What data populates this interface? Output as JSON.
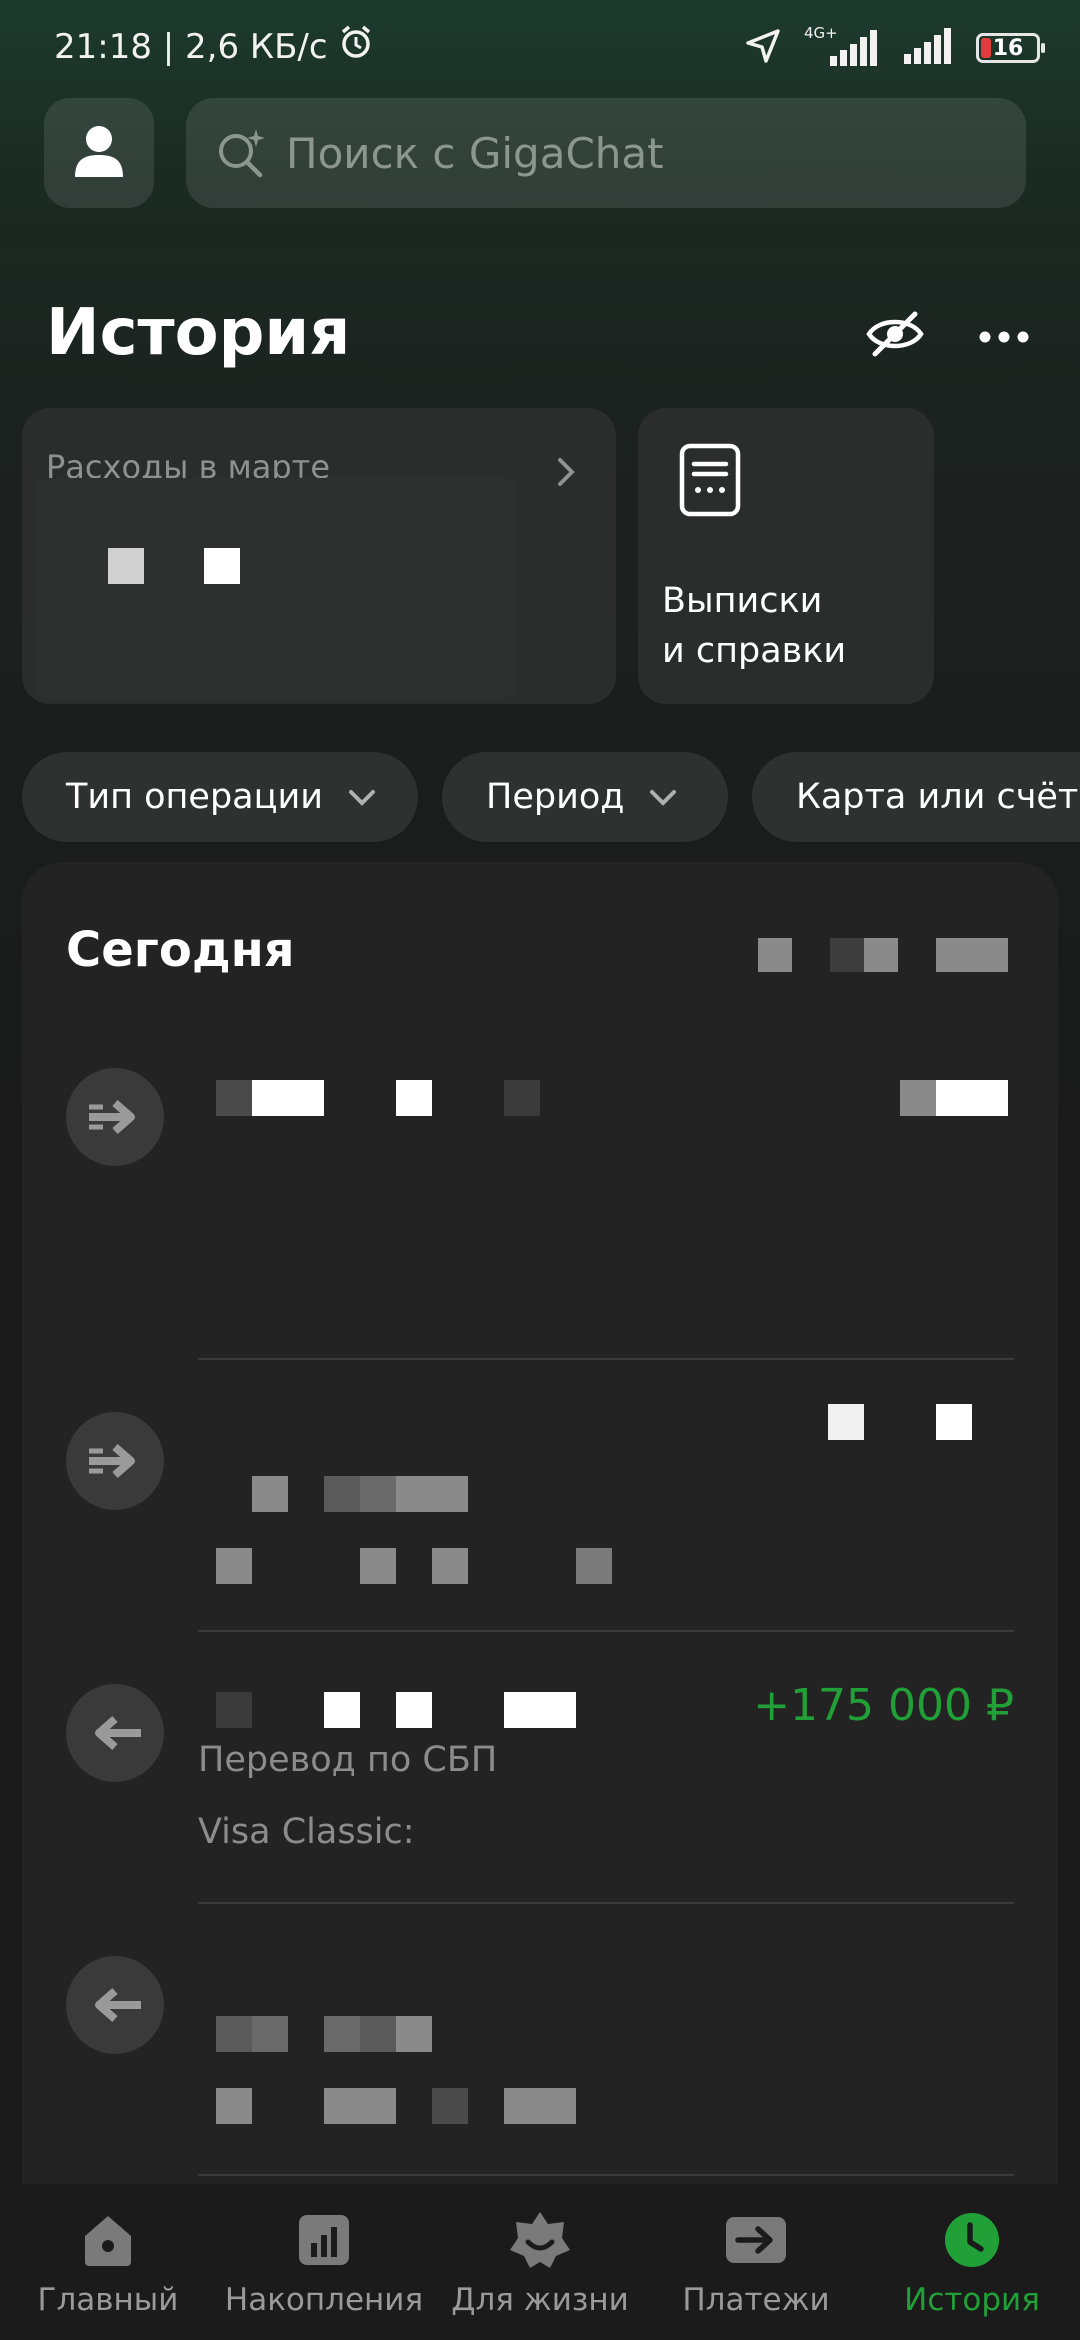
{
  "status_bar": {
    "time_speed": "21:18 | 2,6 КБ/с",
    "network_label": "4G+",
    "battery_level": "16"
  },
  "search": {
    "placeholder": "Поиск с GigaChat"
  },
  "header": {
    "title": "История"
  },
  "cards": {
    "expenses_label": "Расходы в марте",
    "statements_line1": "Выписки",
    "statements_line2": "и справки"
  },
  "filters": [
    {
      "label": "Тип операции"
    },
    {
      "label": "Период"
    },
    {
      "label": "Карта или счёт"
    }
  ],
  "operations": {
    "day_label": "Сегодня",
    "items": [
      {
        "amount": "",
        "subtitle": "",
        "card": ""
      },
      {
        "amount": "",
        "subtitle": "",
        "card": ""
      },
      {
        "amount": "+175 000 ₽",
        "subtitle": "Перевод по СБП",
        "card": "Visa Classic:"
      },
      {
        "amount": "",
        "subtitle": "",
        "card": ""
      }
    ]
  },
  "bottom_nav": [
    {
      "label": "Главный",
      "icon": "home-icon"
    },
    {
      "label": "Накопления",
      "icon": "savings-chart-icon"
    },
    {
      "label": "Для жизни",
      "icon": "star-smile-icon"
    },
    {
      "label": "Платежи",
      "icon": "payments-arrow-icon"
    },
    {
      "label": "История",
      "icon": "history-clock-icon",
      "active": true
    }
  ],
  "colors": {
    "accent_green": "#21a038",
    "background": "#1a1a1a"
  }
}
